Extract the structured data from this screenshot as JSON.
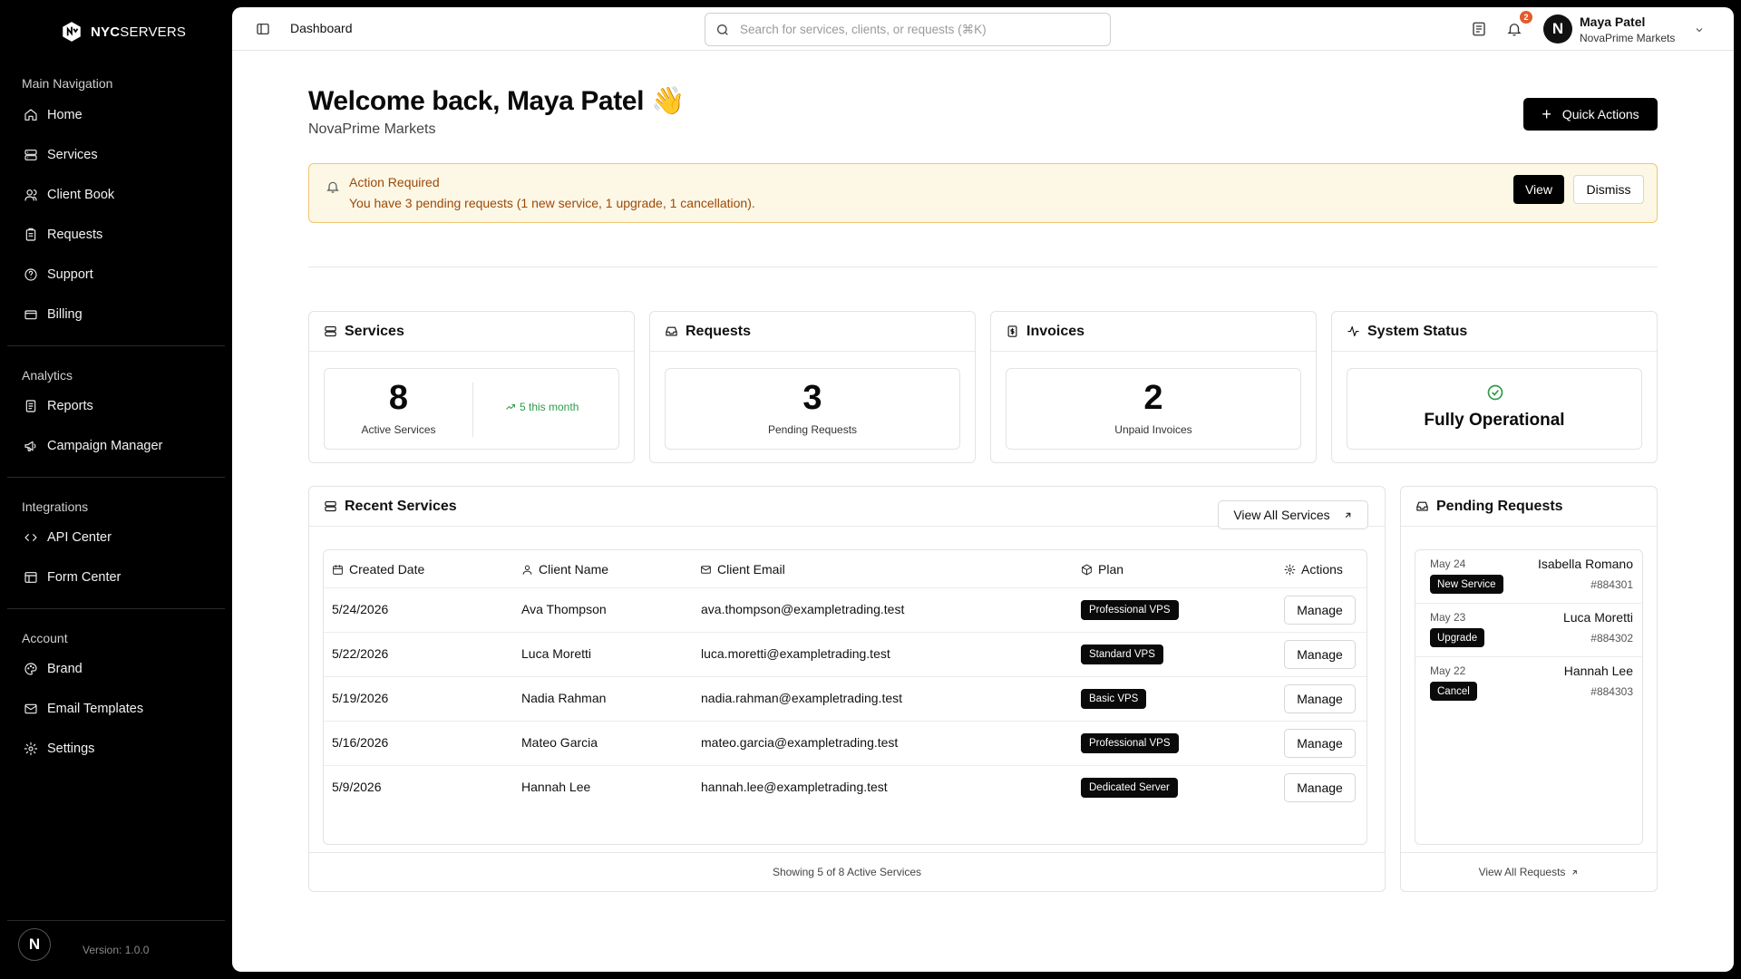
{
  "brand": {
    "logo_bold": "NYC",
    "logo_light": "SERVERS",
    "version": "Version: 1.0.0",
    "avatar_letter": "N"
  },
  "sidebar": {
    "groups": [
      {
        "label": "Main Navigation",
        "items": [
          {
            "label": "Home",
            "icon": "home-icon"
          },
          {
            "label": "Services",
            "icon": "server-icon"
          },
          {
            "label": "Client Book",
            "icon": "users-icon"
          },
          {
            "label": "Requests",
            "icon": "clipboard-icon"
          },
          {
            "label": "Support",
            "icon": "help-icon"
          },
          {
            "label": "Billing",
            "icon": "wallet-icon"
          }
        ]
      },
      {
        "label": "Analytics",
        "items": [
          {
            "label": "Reports",
            "icon": "report-icon"
          },
          {
            "label": "Campaign Manager",
            "icon": "megaphone-icon"
          }
        ]
      },
      {
        "label": "Integrations",
        "items": [
          {
            "label": "API Center",
            "icon": "code-icon"
          },
          {
            "label": "Form Center",
            "icon": "form-icon"
          }
        ]
      },
      {
        "label": "Account",
        "items": [
          {
            "label": "Brand",
            "icon": "palette-icon"
          },
          {
            "label": "Email Templates",
            "icon": "mail-icon"
          },
          {
            "label": "Settings",
            "icon": "gear-icon"
          }
        ]
      }
    ]
  },
  "topbar": {
    "breadcrumb": "Dashboard",
    "search_placeholder": "Search for services, clients, or requests (⌘K)",
    "notification_count": "2",
    "user": {
      "initial": "N",
      "name": "Maya Patel",
      "org": "NovaPrime Markets"
    }
  },
  "welcome": {
    "title": "Welcome back, Maya Patel 👋",
    "subtitle": "NovaPrime Markets",
    "quick_actions": "Quick Actions"
  },
  "alert": {
    "title": "Action Required",
    "message": "You have 3 pending requests (1 new service, 1 upgrade, 1 cancellation).",
    "view": "View",
    "dismiss": "Dismiss"
  },
  "stats": {
    "services": {
      "title": "Services",
      "value": "8",
      "label": "Active Services",
      "trend": "5 this month"
    },
    "requests": {
      "title": "Requests",
      "value": "3",
      "label": "Pending Requests"
    },
    "invoices": {
      "title": "Invoices",
      "value": "2",
      "label": "Unpaid Invoices"
    },
    "status": {
      "title": "System Status",
      "text": "Fully Operational"
    }
  },
  "recent_services": {
    "title": "Recent Services",
    "view_all": "View All Services",
    "columns": [
      "Created Date",
      "Client Name",
      "Client Email",
      "Plan",
      "Actions"
    ],
    "rows": [
      {
        "date": "5/24/2026",
        "name": "Ava Thompson",
        "email": "ava.thompson@exampletrading.test",
        "plan": "Professional VPS",
        "action": "Manage"
      },
      {
        "date": "5/22/2026",
        "name": "Luca Moretti",
        "email": "luca.moretti@exampletrading.test",
        "plan": "Standard VPS",
        "action": "Manage"
      },
      {
        "date": "5/19/2026",
        "name": "Nadia Rahman",
        "email": "nadia.rahman@exampletrading.test",
        "plan": "Basic VPS",
        "action": "Manage"
      },
      {
        "date": "5/16/2026",
        "name": "Mateo Garcia",
        "email": "mateo.garcia@exampletrading.test",
        "plan": "Professional VPS",
        "action": "Manage"
      },
      {
        "date": "5/9/2026",
        "name": "Hannah Lee",
        "email": "hannah.lee@exampletrading.test",
        "plan": "Dedicated Server",
        "action": "Manage"
      }
    ],
    "footer": "Showing 5 of 8 Active Services"
  },
  "pending_requests": {
    "title": "Pending Requests",
    "items": [
      {
        "date": "May 24",
        "type": "New Service",
        "name": "Isabella Romano",
        "id": "#884301"
      },
      {
        "date": "May 23",
        "type": "Upgrade",
        "name": "Luca Moretti",
        "id": "#884302"
      },
      {
        "date": "May 22",
        "type": "Cancel",
        "name": "Hannah Lee",
        "id": "#884303"
      }
    ],
    "footer": "View All Requests"
  },
  "colors": {
    "alert_bg": "#fdf7e6",
    "alert_text": "#9a4a0a",
    "success": "#2e9a4a",
    "badge_bg": "#e35b2d"
  }
}
